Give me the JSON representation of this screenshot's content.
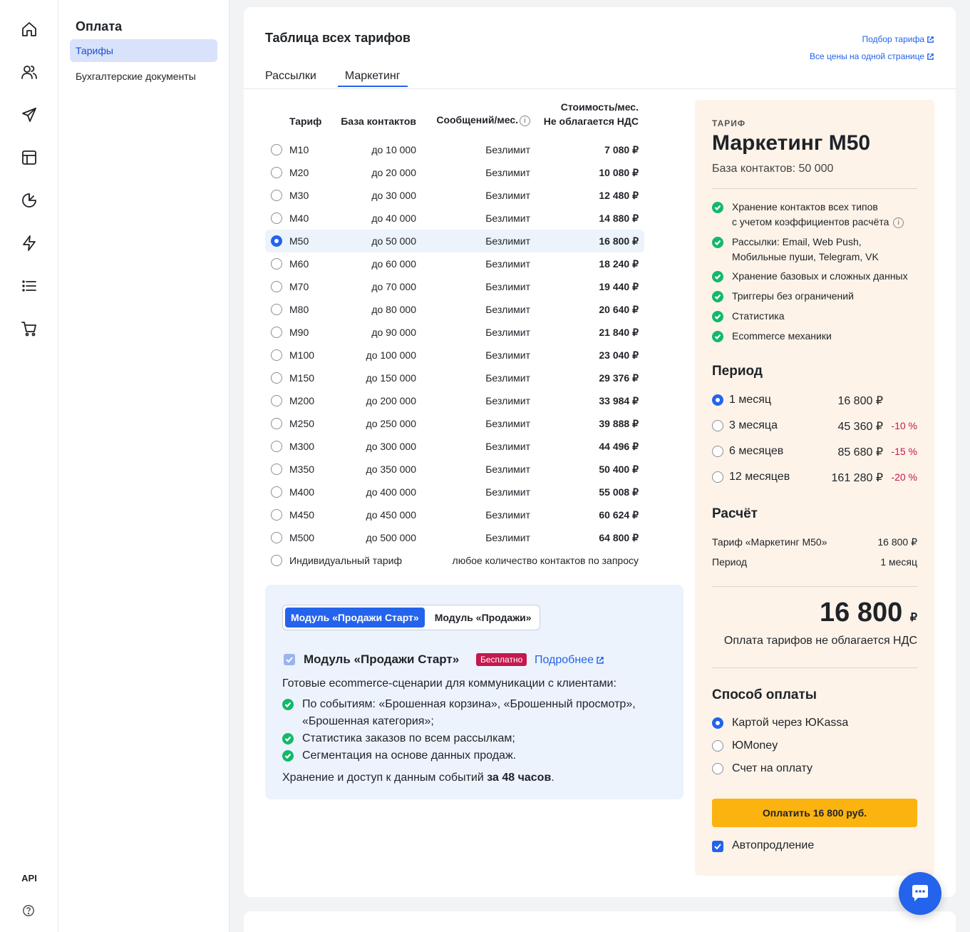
{
  "sidebar": {
    "icons": [
      "home-icon",
      "users-icon",
      "send-icon",
      "layout-icon",
      "pie-chart-icon",
      "lightning-icon",
      "list-icon",
      "cart-icon"
    ],
    "api_label": "API",
    "help_icon": "help-icon"
  },
  "subnav": {
    "title": "Оплата",
    "items": [
      {
        "label": "Тарифы",
        "active": true
      },
      {
        "label": "Бухгалтерские документы",
        "active": false
      }
    ]
  },
  "main": {
    "title": "Таблица всех тарифов",
    "links": [
      "Подбор тарифа",
      "Все цены на одной странице"
    ],
    "tabs": [
      {
        "label": "Рассылки",
        "active": false
      },
      {
        "label": "Маркетинг",
        "active": true
      }
    ],
    "table": {
      "headers": {
        "tariff": "Тариф",
        "base": "База контактов",
        "messages": "Сообщений/мес.",
        "price_line1": "Стоимость/мес.",
        "price_line2": "Не облагается НДС"
      },
      "rows": [
        {
          "name": "M10",
          "base": "до 10 000",
          "messages": "Безлимит",
          "price": "7 080 ₽"
        },
        {
          "name": "M20",
          "base": "до 20 000",
          "messages": "Безлимит",
          "price": "10 080 ₽"
        },
        {
          "name": "M30",
          "base": "до 30 000",
          "messages": "Безлимит",
          "price": "12 480 ₽"
        },
        {
          "name": "M40",
          "base": "до 40 000",
          "messages": "Безлимит",
          "price": "14 880 ₽"
        },
        {
          "name": "M50",
          "base": "до 50 000",
          "messages": "Безлимит",
          "price": "16 800 ₽",
          "selected": true
        },
        {
          "name": "M60",
          "base": "до 60 000",
          "messages": "Безлимит",
          "price": "18 240 ₽"
        },
        {
          "name": "M70",
          "base": "до 70 000",
          "messages": "Безлимит",
          "price": "19 440 ₽"
        },
        {
          "name": "M80",
          "base": "до 80 000",
          "messages": "Безлимит",
          "price": "20 640 ₽"
        },
        {
          "name": "M90",
          "base": "до 90 000",
          "messages": "Безлимит",
          "price": "21 840 ₽"
        },
        {
          "name": "M100",
          "base": "до 100 000",
          "messages": "Безлимит",
          "price": "23 040 ₽"
        },
        {
          "name": "M150",
          "base": "до 150 000",
          "messages": "Безлимит",
          "price": "29 376 ₽"
        },
        {
          "name": "M200",
          "base": "до 200 000",
          "messages": "Безлимит",
          "price": "33 984 ₽"
        },
        {
          "name": "M250",
          "base": "до 250 000",
          "messages": "Безлимит",
          "price": "39 888 ₽"
        },
        {
          "name": "M300",
          "base": "до 300 000",
          "messages": "Безлимит",
          "price": "44 496 ₽"
        },
        {
          "name": "M350",
          "base": "до 350 000",
          "messages": "Безлимит",
          "price": "50 400 ₽"
        },
        {
          "name": "M400",
          "base": "до 400 000",
          "messages": "Безлимит",
          "price": "55 008 ₽"
        },
        {
          "name": "M450",
          "base": "до 450 000",
          "messages": "Безлимит",
          "price": "60 624 ₽"
        },
        {
          "name": "M500",
          "base": "до 500 000",
          "messages": "Безлимит",
          "price": "64 800 ₽"
        }
      ],
      "individual": {
        "name": "Индивидуальный тариф",
        "text": "любое количество контактов по запросу"
      }
    },
    "module": {
      "toggle": [
        "Модуль «Продажи Старт»",
        "Модуль «Продажи»"
      ],
      "title": "Модуль «Продажи Старт»",
      "badge": "Бесплатно",
      "more": "Подробнее",
      "description": "Готовые ecommerce-сценарии для коммуникации с клиентами:",
      "items": [
        "По событиям: «Брошенная корзина», «Брошенный просмотр»,",
        "«Брошенная категория»;",
        "Статистика заказов по всем рассылкам;",
        "Сегментация на основе данных продаж."
      ],
      "footer_text": "Хранение и доступ к данным событий",
      "footer_bold": "за 48 часов",
      "footer_end": "."
    }
  },
  "summary": {
    "label": "ТАРИФ",
    "title": "Маркетинг M50",
    "subtitle": "База контактов: 50 000",
    "features": [
      "Хранение контактов всех типов",
      "с учетом коэффициентов расчёта",
      "Рассылки: Email, Web Push,",
      "Мобильные пуши, Telegram, VK",
      "Хранение базовых и сложных данных",
      "Триггеры без ограничений",
      "Статистика",
      "Ecommerce механики"
    ],
    "period_title": "Период",
    "periods": [
      {
        "label": "1 месяц",
        "price": "16 800 ₽",
        "discount": "",
        "selected": true
      },
      {
        "label": "3 месяца",
        "price": "45 360 ₽",
        "discount": "-10 %"
      },
      {
        "label": "6 месяцев",
        "price": "85 680 ₽",
        "discount": "-15 %"
      },
      {
        "label": "12 месяцев",
        "price": "161 280 ₽",
        "discount": "-20 %"
      }
    ],
    "calc_title": "Расчёт",
    "calc": [
      {
        "label": "Тариф «Маркетинг M50»",
        "value": "16 800 ₽"
      },
      {
        "label": "Период",
        "value": "1 месяц"
      }
    ],
    "total": "16 800",
    "currency": "₽",
    "vat_note": "Оплата тарифов не облагается НДС",
    "payment_title": "Способ оплаты",
    "payment_methods": [
      {
        "label": "Картой через ЮKassa",
        "selected": true
      },
      {
        "label": "ЮMoney"
      },
      {
        "label": "Счет на оплату"
      }
    ],
    "pay_button": "Оплатить 16 800 руб.",
    "autorenew": "Автопродление"
  },
  "colors": {
    "accent": "#2463eb",
    "success": "#14b86b",
    "discount": "#c4184f",
    "pay_button": "#fbb30f",
    "panel_bg": "#fdf3e9"
  }
}
